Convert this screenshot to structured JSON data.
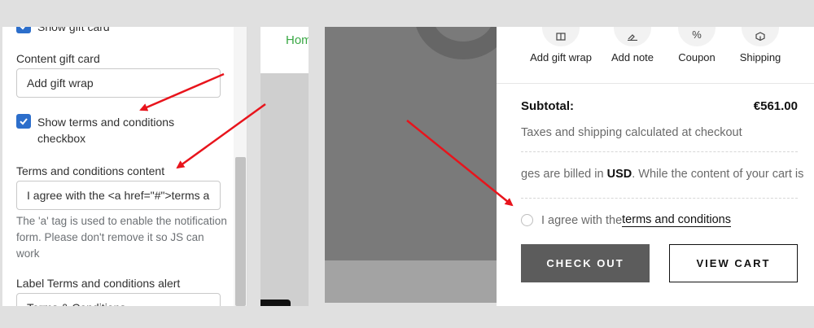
{
  "settings": {
    "show_gift_card_label": "Show gift card",
    "content_gift_card_label": "Content gift card",
    "content_gift_card_value": "Add gift wrap",
    "show_terms_label": "Show terms and conditions checkbox",
    "terms_content_label": "Terms and conditions content",
    "terms_content_value": "I agree with the <a href=\"#\">terms a",
    "terms_help": "The 'a' tag is used to enable the notification form. Please don't remove it so JS can work",
    "terms_alert_label": "Label Terms and conditions alert",
    "terms_alert_value": "Terms & Conditions"
  },
  "preview": {
    "home_link": "Hom"
  },
  "cart": {
    "actions": [
      {
        "label": "Add gift wrap",
        "icon": "gift-icon"
      },
      {
        "label": "Add note",
        "icon": "note-icon"
      },
      {
        "label": "Coupon",
        "icon": "percent-icon"
      },
      {
        "label": "Shipping",
        "icon": "shipping-icon"
      }
    ],
    "subtotal_label": "Subtotal:",
    "subtotal_value": "€561.00",
    "taxes_note": "Taxes and shipping calculated at checkout",
    "currency_prefix": "ges are billed in ",
    "currency_code": "USD",
    "currency_suffix": ". While the content of your cart is",
    "agree_text": "I agree with the ",
    "terms_link": "terms and conditions",
    "checkout_label": "CHECK OUT",
    "view_cart_label": "VIEW CART"
  },
  "colors": {
    "accent_blue": "#2c6ecb",
    "annotation_red": "#e8141c",
    "checkout_bg": "#5c5c5c",
    "home_green": "#3aa845"
  }
}
